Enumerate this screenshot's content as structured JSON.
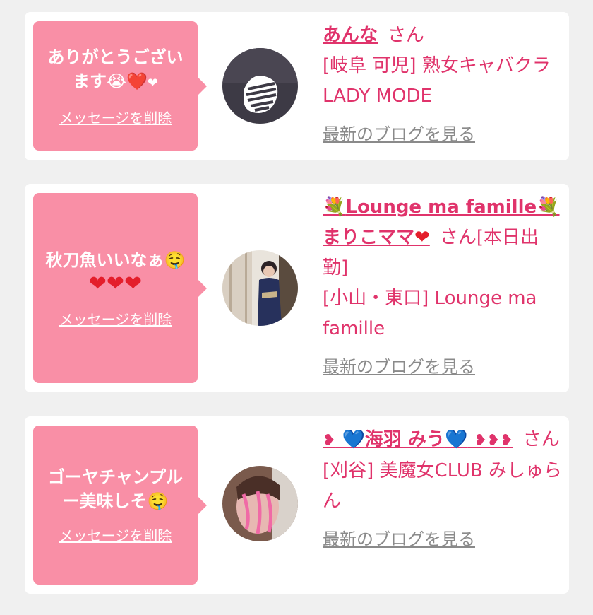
{
  "cards": [
    {
      "message_text": "ありがとうございます",
      "message_emoji": "😭❤️",
      "message_heart": "❤",
      "delete_label": "メッセージを削除",
      "name": "あんな",
      "honorific": "さん",
      "area": "[岐阜 可児] 熟女キャバクラ LADY MODE",
      "blog_link": "最新のブログを見る"
    },
    {
      "message_text": "秋刀魚いいなぁ",
      "message_emoji": "🤤",
      "message_hearts": "❤❤❤",
      "delete_label": "メッセージを削除",
      "name_prefix": "💐",
      "name": "Lounge ma famille",
      "name_suffix": "💐",
      "name_line2": "まりこママ",
      "name_heart": "❤",
      "honorific": "さん",
      "note": "[本日出勤]",
      "area": "[小山・東口] Lounge ma famille",
      "blog_link": "最新のブログを見る"
    },
    {
      "message_text": "ゴーヤチャンプルー美味しそ",
      "message_emoji": "🤤",
      "delete_label": "メッセージを削除",
      "name_prefix_heart": "❥",
      "name_blue_left": "💙",
      "name": "海羽 みう",
      "name_blue_right": "💙",
      "name_suffix_hearts": "❥❥❥",
      "honorific": "さん",
      "area": "[刈谷] 美魔女CLUB みしゅらん",
      "blog_link": "最新のブログを見る"
    }
  ],
  "colors": {
    "accent": "#e0336b",
    "bubble": "#f98fa6",
    "link_gray": "#8a8a8a",
    "background": "#f0f0f0",
    "card": "#ffffff"
  }
}
